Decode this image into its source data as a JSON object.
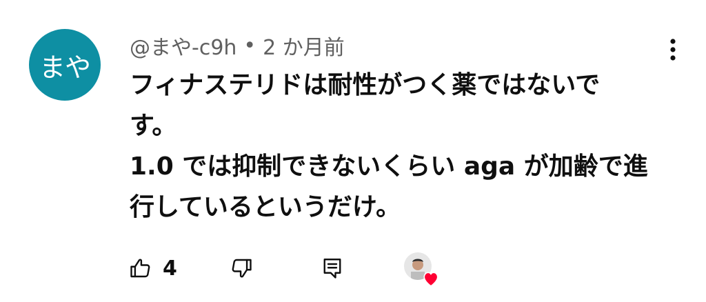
{
  "comment": {
    "avatar_text": "まや",
    "avatar_color": "#0e8fa3",
    "author": "@まや-c9h",
    "separator": "•",
    "time": "2 か月前",
    "text_lines": [
      "フィナステリドは耐性がつく薬ではないで",
      "す。",
      "1.0 では抑制できないくらい aga が加齢で進",
      "行しているというだけ。"
    ],
    "like_count": "4"
  },
  "icons": {
    "more": "more-vert-icon",
    "like": "thumb-up-icon",
    "dislike": "thumb-down-icon",
    "reply": "reply-comment-icon",
    "creator_heart": "creator-heart-icon"
  },
  "colors": {
    "heart": "#ff0033",
    "secondary_text": "#606060"
  }
}
